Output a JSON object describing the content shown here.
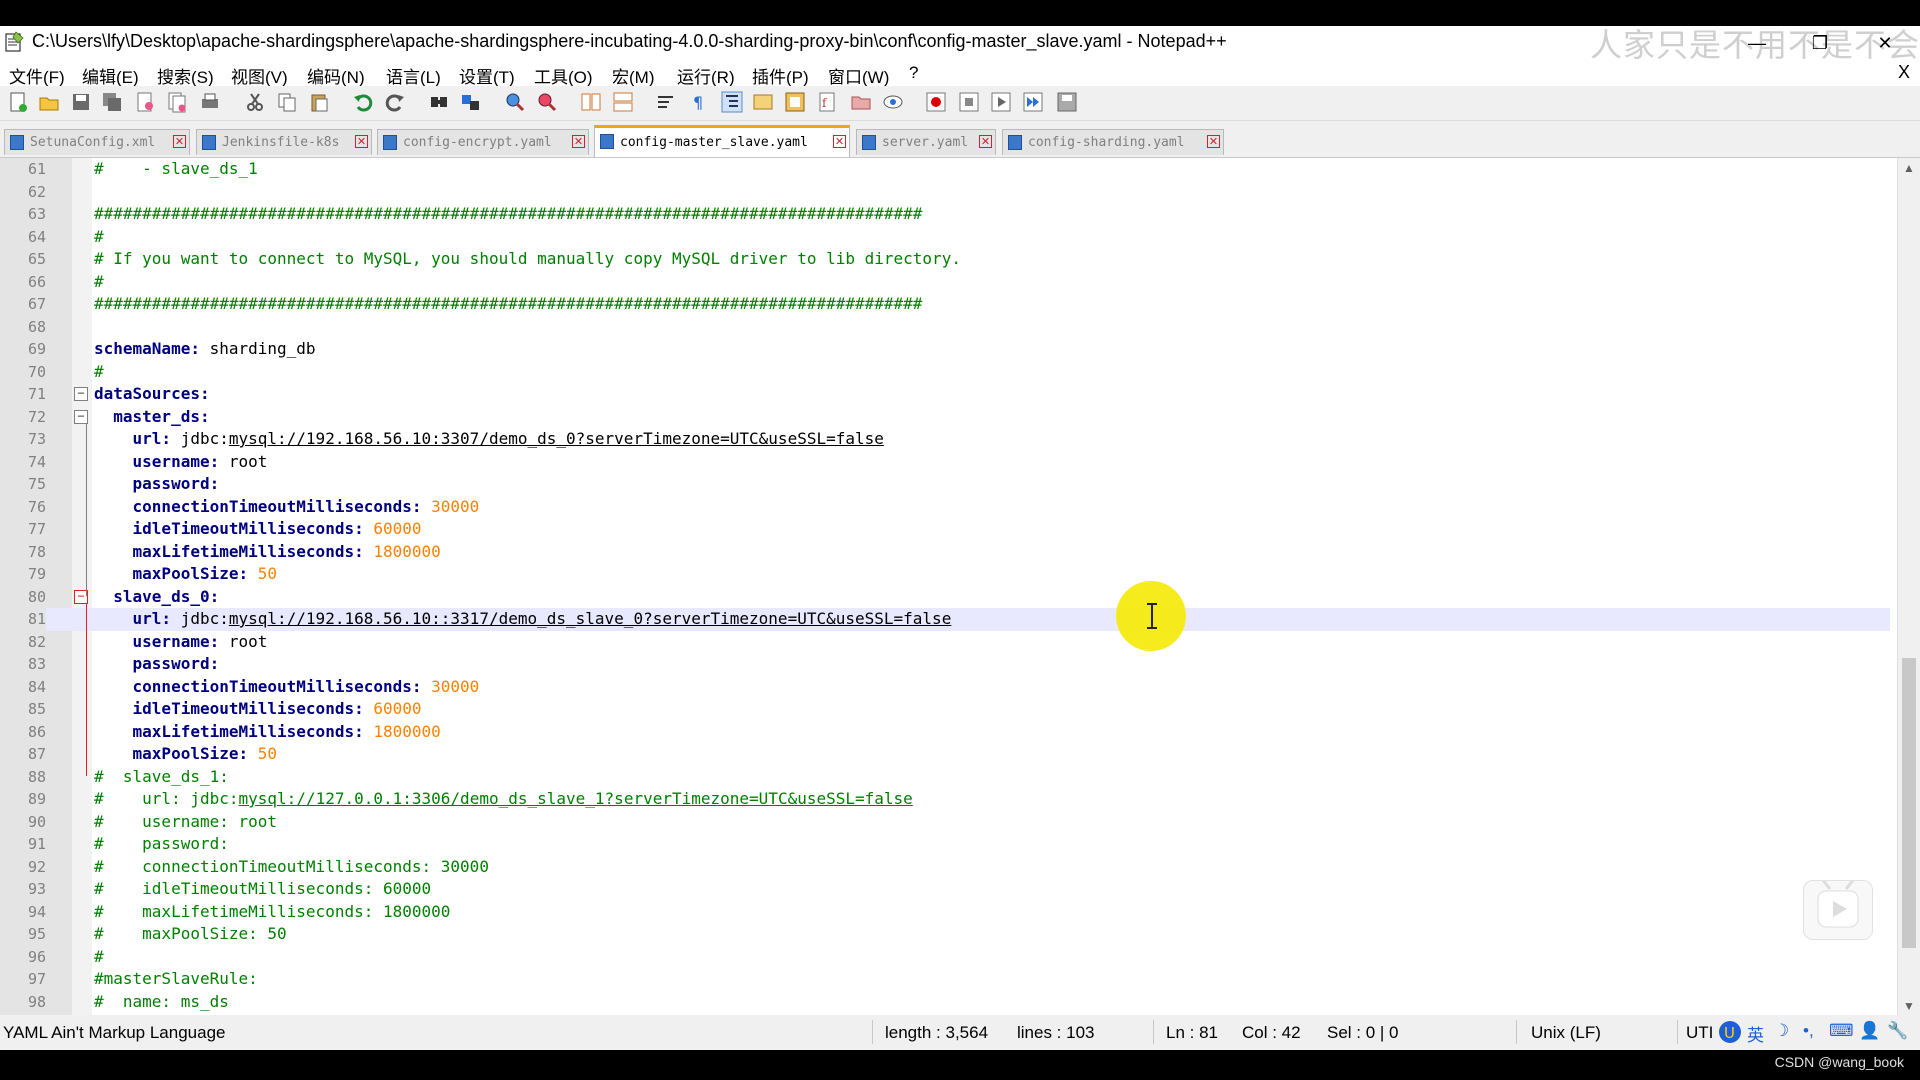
{
  "window": {
    "title": "C:\\Users\\lfy\\Desktop\\apache-shardingsphere\\apache-shardingsphere-incubating-4.0.0-sharding-proxy-bin\\conf\\config-master_slave.yaml - Notepad++",
    "watermark": "人家只是不用不是不会",
    "controls": {
      "minimize": "—",
      "restore": "❐",
      "close": "✕"
    }
  },
  "menu": {
    "items": [
      "文件(F)",
      "编辑(E)",
      "搜索(S)",
      "视图(V)",
      "编码(N)",
      "语言(L)",
      "设置(T)",
      "工具(O)",
      "宏(M)",
      "运行(R)",
      "插件(P)",
      "窗口(W)",
      "?"
    ],
    "close": "X"
  },
  "toolbar": {
    "buttons": [
      "new-file",
      "open-file",
      "save",
      "save-all",
      "close",
      "close-all",
      "print",
      "cut",
      "copy",
      "paste",
      "undo",
      "redo",
      "find",
      "replace",
      "zoom-in",
      "zoom-out",
      "sync-vertical",
      "sync-horizontal",
      "word-wrap",
      "show-all-chars",
      "indent-guide",
      "language-udl",
      "document-map",
      "function-list",
      "folder-workspace",
      "monitoring",
      "record-macro",
      "stop-macro",
      "play-macro",
      "run-macro-multiple",
      "save-macro"
    ]
  },
  "tabs": [
    {
      "label": "SetunaConfig.xml",
      "active": false
    },
    {
      "label": "Jenkinsfile-k8s",
      "active": false
    },
    {
      "label": "config-encrypt.yaml",
      "active": false
    },
    {
      "label": "config-master_slave.yaml",
      "active": true
    },
    {
      "label": "server.yaml",
      "active": false
    },
    {
      "label": "config-sharding.yaml",
      "active": false
    }
  ],
  "editor": {
    "current_line": 81,
    "lines": [
      {
        "n": "61",
        "kind": "comment",
        "text": "#    - slave_ds_1"
      },
      {
        "n": "62",
        "kind": "blank",
        "text": ""
      },
      {
        "n": "63",
        "kind": "comment",
        "text": "######################################################################################"
      },
      {
        "n": "64",
        "kind": "comment",
        "text": "#"
      },
      {
        "n": "65",
        "kind": "comment",
        "text": "# If you want to connect to MySQL, you should manually copy MySQL driver to lib directory."
      },
      {
        "n": "66",
        "kind": "comment",
        "text": "#"
      },
      {
        "n": "67",
        "kind": "comment",
        "text": "######################################################################################"
      },
      {
        "n": "68",
        "kind": "blank",
        "text": ""
      },
      {
        "n": "69",
        "kind": "kv",
        "indent": "",
        "key": "schemaName:",
        "value": " sharding_db"
      },
      {
        "n": "70",
        "kind": "comment",
        "text": "#"
      },
      {
        "n": "71",
        "kind": "kv",
        "indent": "",
        "key": "dataSources:",
        "value": "",
        "fold": "minus"
      },
      {
        "n": "72",
        "kind": "kv",
        "indent": "  ",
        "key": "master_ds:",
        "value": "",
        "fold": "minus"
      },
      {
        "n": "73",
        "kind": "url",
        "indent": "    ",
        "key": "url:",
        "prefix": " jdbc:",
        "link": "mysql://192.168.56.10:3307/demo_ds_0?serverTimezone=UTC&useSSL=false"
      },
      {
        "n": "74",
        "kind": "kv",
        "indent": "    ",
        "key": "username:",
        "value": " root"
      },
      {
        "n": "75",
        "kind": "kv",
        "indent": "    ",
        "key": "password:",
        "value": ""
      },
      {
        "n": "76",
        "kind": "num",
        "indent": "    ",
        "key": "connectionTimeoutMilliseconds:",
        "value": " 30000"
      },
      {
        "n": "77",
        "kind": "num",
        "indent": "    ",
        "key": "idleTimeoutMilliseconds:",
        "value": " 60000"
      },
      {
        "n": "78",
        "kind": "num",
        "indent": "    ",
        "key": "maxLifetimeMilliseconds:",
        "value": " 1800000"
      },
      {
        "n": "79",
        "kind": "num",
        "indent": "    ",
        "key": "maxPoolSize:",
        "value": " 50"
      },
      {
        "n": "80",
        "kind": "kv",
        "indent": "  ",
        "key": "slave_ds_0:",
        "value": "",
        "fold": "minus-red"
      },
      {
        "n": "81",
        "kind": "url",
        "indent": "    ",
        "key": "url:",
        "prefix": " jdbc:",
        "link": "mysql://192.168.56.10::3317/demo_ds_slave_0?serverTimezone=UTC&useSSL=false"
      },
      {
        "n": "82",
        "kind": "kv",
        "indent": "    ",
        "key": "username:",
        "value": " root"
      },
      {
        "n": "83",
        "kind": "kv",
        "indent": "    ",
        "key": "password:",
        "value": ""
      },
      {
        "n": "84",
        "kind": "num",
        "indent": "    ",
        "key": "connectionTimeoutMilliseconds:",
        "value": " 30000"
      },
      {
        "n": "85",
        "kind": "num",
        "indent": "    ",
        "key": "idleTimeoutMilliseconds:",
        "value": " 60000"
      },
      {
        "n": "86",
        "kind": "num",
        "indent": "    ",
        "key": "maxLifetimeMilliseconds:",
        "value": " 1800000"
      },
      {
        "n": "87",
        "kind": "num",
        "indent": "    ",
        "key": "maxPoolSize:",
        "value": " 50"
      },
      {
        "n": "88",
        "kind": "comment",
        "text": "#  slave_ds_1:"
      },
      {
        "n": "89",
        "kind": "commenturl",
        "prefix": "#    url: jdbc:",
        "link": "mysql://127.0.0.1:3306/demo_ds_slave_1?serverTimezone=UTC&useSSL=false"
      },
      {
        "n": "90",
        "kind": "comment",
        "text": "#    username: root"
      },
      {
        "n": "91",
        "kind": "comment",
        "text": "#    password:"
      },
      {
        "n": "92",
        "kind": "comment",
        "text": "#    connectionTimeoutMilliseconds: 30000"
      },
      {
        "n": "93",
        "kind": "comment",
        "text": "#    idleTimeoutMilliseconds: 60000"
      },
      {
        "n": "94",
        "kind": "comment",
        "text": "#    maxLifetimeMilliseconds: 1800000"
      },
      {
        "n": "95",
        "kind": "comment",
        "text": "#    maxPoolSize: 50"
      },
      {
        "n": "96",
        "kind": "comment",
        "text": "#"
      },
      {
        "n": "97",
        "kind": "comment",
        "text": "#masterSlaveRule:"
      },
      {
        "n": "98",
        "kind": "comment",
        "text": "#  name: ms_ds"
      }
    ]
  },
  "status": {
    "language": "YAML Ain't Markup Language",
    "length": "length : 3,564",
    "lines": "lines : 103",
    "ln": "Ln : 81",
    "col": "Col : 42",
    "sel": "Sel : 0 | 0",
    "eol": "Unix (LF)",
    "encoding": "UTI",
    "ime": [
      "英",
      "☽",
      "•,",
      "⌨",
      "👤",
      "🔧"
    ]
  },
  "credit": "CSDN @wang_book",
  "colors": {
    "comment": "#008000",
    "key": "#000080",
    "number": "#ff8000",
    "active_tab_accent": "#f9a01b"
  }
}
